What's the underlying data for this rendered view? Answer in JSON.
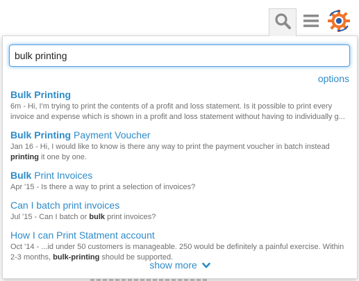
{
  "header": {
    "icons": [
      "search-icon",
      "hamburger-menu-icon",
      "gear-logo-icon"
    ]
  },
  "search": {
    "value": "bulk printing",
    "options_label": "options"
  },
  "results": [
    {
      "title_parts": [
        {
          "text": "Bulk Printing",
          "bold": true
        }
      ],
      "snippet_parts": [
        {
          "text": "6m - Hi, I'm trying to print the contents of a profit and loss statement. Is it possible to print every invoice and expense which is shown in a profit and loss statement without having to individually g...",
          "bold": false
        }
      ]
    },
    {
      "title_parts": [
        {
          "text": "Bulk Printing",
          "bold": true
        },
        {
          "text": " Payment Voucher",
          "bold": false
        }
      ],
      "snippet_parts": [
        {
          "text": "Jan 16 - Hi, I would like to know is there any way to print the payment voucher in batch instead ",
          "bold": false
        },
        {
          "text": "printing",
          "bold": true
        },
        {
          "text": " it one by one.",
          "bold": false
        }
      ]
    },
    {
      "title_parts": [
        {
          "text": "Bulk",
          "bold": true
        },
        {
          "text": " Print Invoices",
          "bold": false
        }
      ],
      "snippet_parts": [
        {
          "text": "Apr '15 - Is there a way to print a selection of invoices?",
          "bold": false
        }
      ]
    },
    {
      "title_parts": [
        {
          "text": "Can I batch print invoices",
          "bold": false
        }
      ],
      "snippet_parts": [
        {
          "text": "Jul '15 - Can I batch or ",
          "bold": false
        },
        {
          "text": "bulk",
          "bold": true
        },
        {
          "text": " print invoices?",
          "bold": false
        }
      ]
    },
    {
      "title_parts": [
        {
          "text": "How I can Print Statment account",
          "bold": false
        }
      ],
      "snippet_parts": [
        {
          "text": "Oct '14 - ...id under 50 customers is manageable. 250 would be definitely a painful exercise. Within 2-3 months, ",
          "bold": false
        },
        {
          "text": "bulk-printing",
          "bold": true
        },
        {
          "text": " should be supported.",
          "bold": false
        }
      ]
    }
  ],
  "footer": {
    "show_more_label": "show more",
    "show_more_icon": "chevron-down-icon"
  },
  "colors": {
    "link": "#2e8bc9",
    "snippet": "#6f6f6f",
    "input_focus": "#5b9ed6",
    "icon_gray": "#8a8a8a",
    "logo_orange": "#f0752a",
    "logo_blue": "#2a5caa"
  }
}
